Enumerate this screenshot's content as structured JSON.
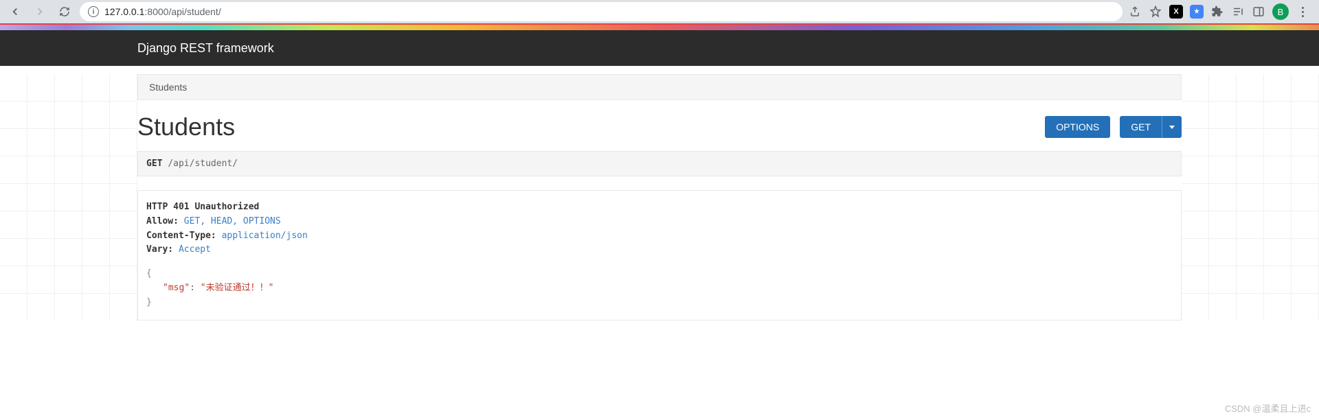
{
  "browser": {
    "url_host": "127.0.0.1",
    "url_port": ":8000",
    "url_path": "/api/student/",
    "avatar_letter": "B"
  },
  "header": {
    "title": "Django REST framework"
  },
  "breadcrumb": {
    "current": "Students"
  },
  "page": {
    "title": "Students",
    "options_btn": "OPTIONS",
    "get_btn": "GET"
  },
  "request": {
    "method": "GET",
    "path": "/api/student/"
  },
  "response": {
    "status_line": "HTTP 401 Unauthorized",
    "headers": [
      {
        "key": "Allow:",
        "value": "GET, HEAD, OPTIONS"
      },
      {
        "key": "Content-Type:",
        "value": "application/json"
      },
      {
        "key": "Vary:",
        "value": "Accept"
      }
    ],
    "body": {
      "open": "{",
      "key": "\"msg\"",
      "colon": ":",
      "value": "\"未验证通过！！\"",
      "close": "}"
    }
  },
  "watermark": "CSDN @温柔且上进c"
}
